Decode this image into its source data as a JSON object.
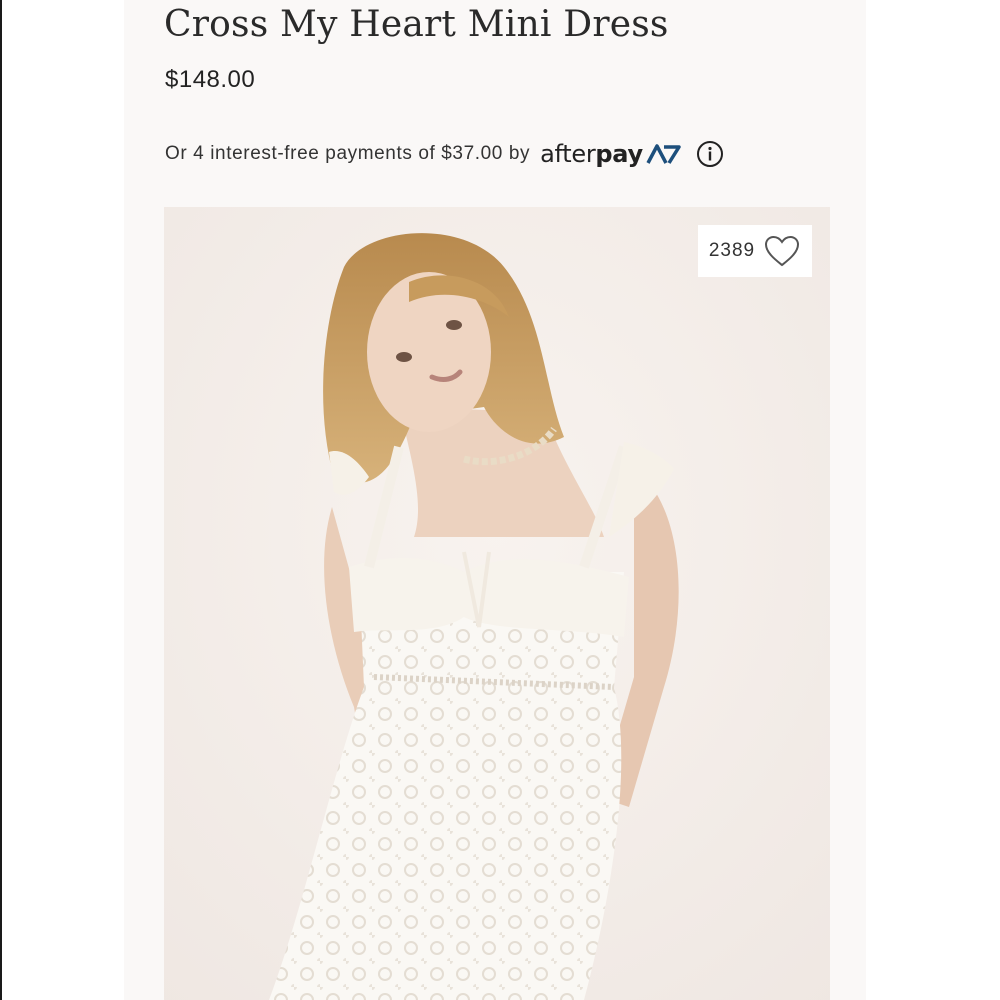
{
  "product": {
    "title": "Cross My Heart Mini Dress",
    "price": "$148.00"
  },
  "afterpay": {
    "text": "Or 4 interest-free payments of $37.00 by",
    "logo_light": "after",
    "logo_bold": "pay",
    "logo_icon": "afterpay-arrows-icon",
    "info_icon": "info-icon",
    "accent_color": "#1d4f7c"
  },
  "image": {
    "like_count": "2389",
    "like_icon": "heart-outline-icon"
  }
}
